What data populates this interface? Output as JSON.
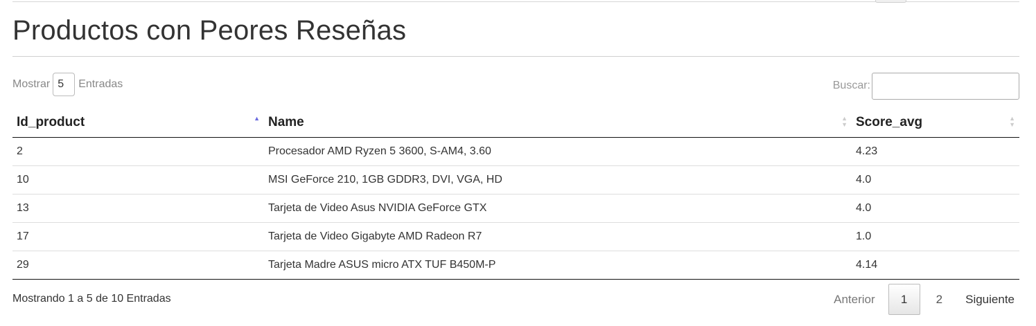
{
  "page": {
    "title": "Productos con Peores Reseñas"
  },
  "length": {
    "label_before": "Mostrar",
    "value": "5",
    "label_after": "Entradas"
  },
  "search": {
    "label": "Buscar:",
    "value": ""
  },
  "table": {
    "columns": [
      {
        "label": "Id_product",
        "sort": "asc"
      },
      {
        "label": "Name",
        "sort": "both"
      },
      {
        "label": "Score_avg",
        "sort": "both"
      }
    ],
    "rows": [
      {
        "id": "2",
        "name": "Procesador AMD Ryzen 5 3600, S-AM4, 3.60",
        "score": "4.23"
      },
      {
        "id": "10",
        "name": "MSI GeForce 210, 1GB GDDR3, DVI, VGA, HD",
        "score": "4.0"
      },
      {
        "id": "13",
        "name": "Tarjeta de Video Asus NVIDIA GeForce GTX",
        "score": "4.0"
      },
      {
        "id": "17",
        "name": "Tarjeta de Video Gigabyte AMD Radeon R7",
        "score": "1.0"
      },
      {
        "id": "29",
        "name": "Tarjeta Madre ASUS micro ATX TUF B450M-P",
        "score": "4.14"
      }
    ]
  },
  "info": {
    "text": "Mostrando 1 a 5 de 10 Entradas"
  },
  "pagination": {
    "previous": "Anterior",
    "pages": [
      "1",
      "2"
    ],
    "current": "1",
    "next": "Siguiente"
  },
  "colors": {
    "sort_active": "#6a6adf",
    "sort_inactive": "#cccccc",
    "rule": "#111111"
  },
  "icons": {
    "sort_asc": "sort-ascending-icon",
    "sort_both": "sort-both-icon"
  }
}
